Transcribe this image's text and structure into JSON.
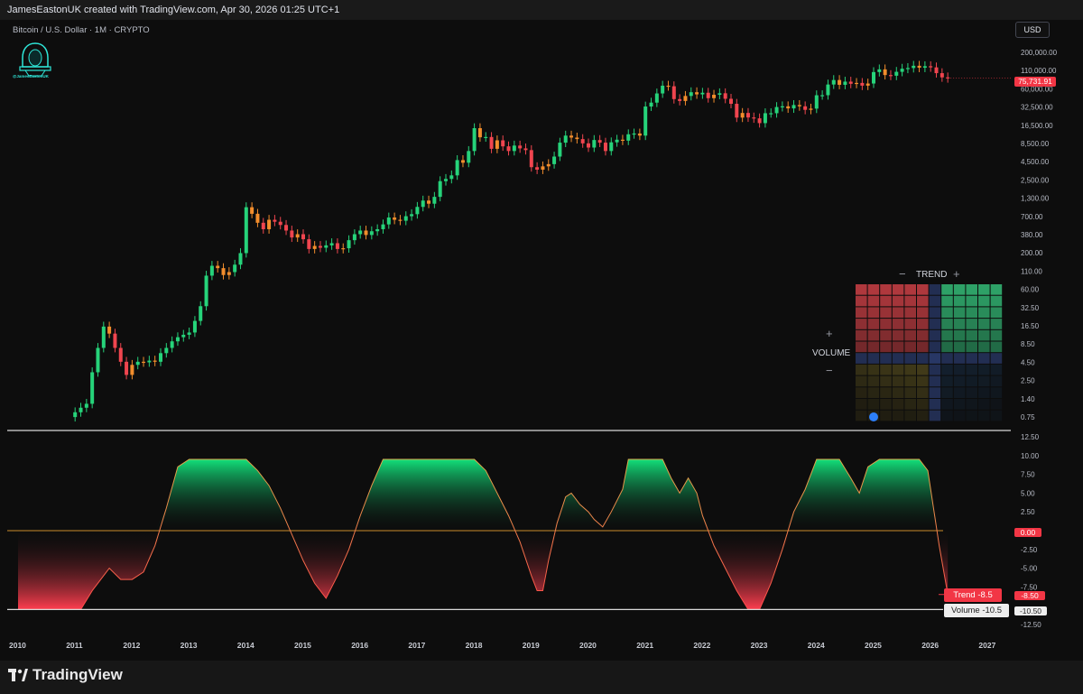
{
  "header": {
    "title": "JamesEastonUK created with TradingView.com, Apr 30, 2026 01:25 UTC+1"
  },
  "symbol": "Bitcoin / U.S. Dollar · 1M · CRYPTO",
  "currency": "USD",
  "author_badge": "@JamesEastonUK",
  "brand": "TradingView",
  "colors": {
    "bull": "#26d37a",
    "bear": "#f0454f",
    "orange": "#f28d2c",
    "green_area": "#19c76e",
    "red_area": "#ff3e4f",
    "zero_line": "#c98a2c"
  },
  "chart_data": [
    {
      "type": "candlestick",
      "title": "Bitcoin / U.S. Dollar · 1M · CRYPTO",
      "scale": "log",
      "y_tick_labels": [
        "200,000.00",
        "110,000.00",
        "60,000.00",
        "32,500.00",
        "16,500.00",
        "8,500.00",
        "4,500.00",
        "2,500.00",
        "1,300.00",
        "700.00",
        "380.00",
        "200.00",
        "110.00",
        "60.00",
        "32.50",
        "16.50",
        "8.50",
        "4.50",
        "2.50",
        "1.40",
        "0.75"
      ],
      "x_tick_labels": [
        "2010",
        "2011",
        "2012",
        "2013",
        "2014",
        "2015",
        "2016",
        "2017",
        "2018",
        "2019",
        "2020",
        "2021",
        "2022",
        "2023",
        "2024",
        "2025",
        "2026",
        "2027"
      ],
      "last_price_label": "75,731.91",
      "last_price": 75731.91,
      "close_series": [
        [
          2011.0,
          0.9
        ],
        [
          2011.1,
          1.05
        ],
        [
          2011.2,
          1.2
        ],
        [
          2011.3,
          3.5
        ],
        [
          2011.4,
          8.0
        ],
        [
          2011.5,
          16.5
        ],
        [
          2011.6,
          13.0
        ],
        [
          2011.7,
          8.0
        ],
        [
          2011.8,
          5.0
        ],
        [
          2011.9,
          3.2
        ],
        [
          2012.0,
          4.5
        ],
        [
          2012.1,
          5.0
        ],
        [
          2012.2,
          4.9
        ],
        [
          2012.3,
          5.2
        ],
        [
          2012.4,
          5.0
        ],
        [
          2012.5,
          6.7
        ],
        [
          2012.6,
          8.0
        ],
        [
          2012.7,
          10.0
        ],
        [
          2012.8,
          11.5
        ],
        [
          2012.9,
          12.5
        ],
        [
          2013.0,
          13.5
        ],
        [
          2013.1,
          20
        ],
        [
          2013.2,
          33
        ],
        [
          2013.3,
          93
        ],
        [
          2013.4,
          130
        ],
        [
          2013.5,
          120
        ],
        [
          2013.6,
          95
        ],
        [
          2013.7,
          105
        ],
        [
          2013.8,
          135
        ],
        [
          2013.9,
          200
        ],
        [
          2014.0,
          950
        ],
        [
          2014.1,
          760
        ],
        [
          2014.2,
          560
        ],
        [
          2014.3,
          450
        ],
        [
          2014.4,
          620
        ],
        [
          2014.5,
          580
        ],
        [
          2014.6,
          520
        ],
        [
          2014.7,
          430
        ],
        [
          2014.8,
          340
        ],
        [
          2014.9,
          380
        ],
        [
          2015.0,
          320
        ],
        [
          2015.1,
          230
        ],
        [
          2015.2,
          255
        ],
        [
          2015.3,
          240
        ],
        [
          2015.4,
          260
        ],
        [
          2015.5,
          280
        ],
        [
          2015.6,
          230
        ],
        [
          2015.7,
          236
        ],
        [
          2015.8,
          310
        ],
        [
          2015.9,
          380
        ],
        [
          2016.0,
          430
        ],
        [
          2016.1,
          370
        ],
        [
          2016.2,
          420
        ],
        [
          2016.3,
          450
        ],
        [
          2016.4,
          530
        ],
        [
          2016.5,
          670
        ],
        [
          2016.6,
          620
        ],
        [
          2016.7,
          600
        ],
        [
          2016.8,
          700
        ],
        [
          2016.9,
          750
        ],
        [
          2017.0,
          960
        ],
        [
          2017.1,
          1190
        ],
        [
          2017.2,
          1070
        ],
        [
          2017.3,
          1350
        ],
        [
          2017.4,
          2300
        ],
        [
          2017.5,
          2480
        ],
        [
          2017.6,
          2800
        ],
        [
          2017.7,
          4700
        ],
        [
          2017.8,
          4300
        ],
        [
          2017.9,
          6400
        ],
        [
          2018.0,
          13900
        ],
        [
          2018.1,
          10200
        ],
        [
          2018.2,
          10300
        ],
        [
          2018.3,
          6900
        ],
        [
          2018.4,
          9200
        ],
        [
          2018.5,
          7500
        ],
        [
          2018.6,
          6400
        ],
        [
          2018.7,
          7700
        ],
        [
          2018.8,
          7000
        ],
        [
          2018.9,
          6600
        ],
        [
          2019.0,
          3700
        ],
        [
          2019.1,
          3400
        ],
        [
          2019.2,
          3800
        ],
        [
          2019.3,
          4100
        ],
        [
          2019.4,
          5300
        ],
        [
          2019.5,
          8500
        ],
        [
          2019.6,
          10800
        ],
        [
          2019.7,
          10100
        ],
        [
          2019.8,
          9600
        ],
        [
          2019.9,
          8300
        ],
        [
          2020.0,
          7200
        ],
        [
          2020.1,
          9300
        ],
        [
          2020.2,
          8500
        ],
        [
          2020.3,
          6400
        ],
        [
          2020.4,
          8600
        ],
        [
          2020.5,
          9400
        ],
        [
          2020.6,
          9100
        ],
        [
          2020.7,
          11300
        ],
        [
          2020.8,
          11600
        ],
        [
          2020.9,
          10800
        ],
        [
          2021.0,
          29000
        ],
        [
          2021.1,
          33100
        ],
        [
          2021.2,
          45200
        ],
        [
          2021.3,
          58800
        ],
        [
          2021.4,
          57700
        ],
        [
          2021.5,
          37300
        ],
        [
          2021.6,
          35000
        ],
        [
          2021.7,
          41500
        ],
        [
          2021.8,
          47100
        ],
        [
          2021.9,
          43800
        ],
        [
          2022.0,
          46300
        ],
        [
          2022.1,
          38500
        ],
        [
          2022.2,
          43200
        ],
        [
          2022.3,
          45500
        ],
        [
          2022.4,
          37700
        ],
        [
          2022.5,
          31800
        ],
        [
          2022.6,
          19900
        ],
        [
          2022.7,
          23300
        ],
        [
          2022.8,
          20000
        ],
        [
          2022.9,
          19400
        ],
        [
          2023.0,
          16500
        ],
        [
          2023.1,
          23100
        ],
        [
          2023.2,
          23100
        ],
        [
          2023.3,
          28500
        ],
        [
          2023.4,
          29200
        ],
        [
          2023.5,
          27200
        ],
        [
          2023.6,
          30500
        ],
        [
          2023.7,
          29200
        ],
        [
          2023.8,
          25900
        ],
        [
          2023.9,
          27000
        ],
        [
          2024.0,
          42500
        ],
        [
          2024.1,
          42600
        ],
        [
          2024.2,
          61200
        ],
        [
          2024.3,
          71300
        ],
        [
          2024.4,
          60600
        ],
        [
          2024.5,
          67500
        ],
        [
          2024.6,
          62700
        ],
        [
          2024.7,
          64600
        ],
        [
          2024.8,
          58900
        ],
        [
          2024.9,
          63300
        ],
        [
          2025.0,
          93400
        ],
        [
          2025.1,
          102400
        ],
        [
          2025.2,
          84400
        ],
        [
          2025.3,
          82500
        ],
        [
          2025.4,
          94200
        ],
        [
          2025.5,
          104600
        ],
        [
          2025.6,
          107100
        ],
        [
          2025.7,
          115700
        ],
        [
          2025.8,
          108200
        ],
        [
          2025.9,
          114000
        ],
        [
          2026.0,
          109500
        ],
        [
          2026.1,
          90000
        ],
        [
          2026.2,
          78000
        ],
        [
          2026.3,
          75731.91
        ]
      ]
    },
    {
      "type": "area",
      "name": "Trend",
      "y_range": [
        -12.5,
        12.5
      ],
      "y_tick_labels": [
        "12.50",
        "10.00",
        "7.50",
        "5.00",
        "2.50",
        "0.00",
        "-2.50",
        "-5.00",
        "-7.50",
        "-10.50",
        "-12.50"
      ],
      "trend_label": "Trend -8.5",
      "trend_value_label": "-8.50",
      "zero_label": "0.00",
      "volume_label": "Volume -10.5",
      "volume_value_label": "-10.50",
      "series": [
        {
          "name": "Trend",
          "points": [
            [
              2010.0,
              -10.5
            ],
            [
              2011.1,
              -10.5
            ],
            [
              2011.3,
              -8.0
            ],
            [
              2011.6,
              -5.0
            ],
            [
              2011.8,
              -6.5
            ],
            [
              2012.0,
              -6.5
            ],
            [
              2012.2,
              -5.5
            ],
            [
              2012.4,
              -2.0
            ],
            [
              2012.6,
              3.0
            ],
            [
              2012.8,
              8.5
            ],
            [
              2013.0,
              9.5
            ],
            [
              2013.5,
              9.5
            ],
            [
              2014.0,
              9.5
            ],
            [
              2014.2,
              8.0
            ],
            [
              2014.4,
              6.0
            ],
            [
              2014.6,
              3.0
            ],
            [
              2014.8,
              -0.5
            ],
            [
              2015.0,
              -4.0
            ],
            [
              2015.2,
              -7.0
            ],
            [
              2015.4,
              -9.0
            ],
            [
              2015.6,
              -6.0
            ],
            [
              2015.8,
              -2.5
            ],
            [
              2016.0,
              2.0
            ],
            [
              2016.2,
              6.0
            ],
            [
              2016.4,
              9.5
            ],
            [
              2017.0,
              9.5
            ],
            [
              2018.0,
              9.5
            ],
            [
              2018.2,
              8.0
            ],
            [
              2018.4,
              5.0
            ],
            [
              2018.6,
              2.0
            ],
            [
              2018.8,
              -1.5
            ],
            [
              2019.0,
              -6.0
            ],
            [
              2019.1,
              -8.0
            ],
            [
              2019.2,
              -8.0
            ],
            [
              2019.3,
              -4.0
            ],
            [
              2019.45,
              1.0
            ],
            [
              2019.6,
              4.5
            ],
            [
              2019.7,
              5.0
            ],
            [
              2019.85,
              3.5
            ],
            [
              2020.0,
              2.5
            ],
            [
              2020.1,
              1.5
            ],
            [
              2020.25,
              0.5
            ],
            [
              2020.4,
              2.5
            ],
            [
              2020.6,
              5.5
            ],
            [
              2020.7,
              9.5
            ],
            [
              2021.0,
              9.5
            ],
            [
              2021.3,
              9.5
            ],
            [
              2021.45,
              7.0
            ],
            [
              2021.6,
              5.0
            ],
            [
              2021.75,
              7.0
            ],
            [
              2021.9,
              5.0
            ],
            [
              2022.0,
              2.0
            ],
            [
              2022.2,
              -2.0
            ],
            [
              2022.4,
              -5.0
            ],
            [
              2022.6,
              -8.0
            ],
            [
              2022.8,
              -10.5
            ],
            [
              2023.0,
              -10.5
            ],
            [
              2023.2,
              -7.0
            ],
            [
              2023.4,
              -2.5
            ],
            [
              2023.6,
              2.5
            ],
            [
              2023.8,
              5.5
            ],
            [
              2024.0,
              9.5
            ],
            [
              2024.4,
              9.5
            ],
            [
              2024.6,
              7.0
            ],
            [
              2024.75,
              5.0
            ],
            [
              2024.9,
              8.5
            ],
            [
              2025.1,
              9.5
            ],
            [
              2025.8,
              9.5
            ],
            [
              2025.95,
              8.0
            ],
            [
              2026.05,
              3.0
            ],
            [
              2026.15,
              -2.0
            ],
            [
              2026.3,
              -8.5
            ]
          ]
        }
      ]
    }
  ],
  "matrix": {
    "title": "TREND",
    "side_label": "VOLUME",
    "minus_symbol": "−",
    "plus_symbol": "+",
    "current_cell": [
      2,
      9
    ]
  }
}
